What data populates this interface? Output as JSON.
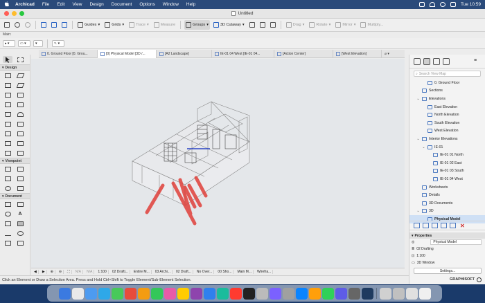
{
  "menubar": {
    "app_name": "Archicad",
    "items": [
      "File",
      "Edit",
      "View",
      "Design",
      "Document",
      "Options",
      "Window",
      "Help"
    ],
    "clock": "Tue 10:59"
  },
  "window": {
    "title": "Untitled"
  },
  "toolbar": {
    "guides": "Guides",
    "grids": "Grids",
    "trace": "Trace",
    "measure": "Measure",
    "groups": "Groups",
    "cutaway": "3D Cutaway",
    "drag": "Drag",
    "rotate": "Rotate",
    "mirror": "Mirror",
    "multiply": "Multiply..."
  },
  "infobox": {
    "label": "Main:"
  },
  "tabs": [
    {
      "label": "0. Ground Floor [0. Grou..."
    },
    {
      "label": "[0] Physical Model [3D /..."
    },
    {
      "label": "[A2 Landscape]"
    },
    {
      "label": "IE-01 04 West [IE-01 04..."
    },
    {
      "label": "[Action Center]"
    },
    {
      "label": "[West Elevation]"
    }
  ],
  "toolbox": {
    "sections": {
      "design": "Design",
      "viewpoint": "Viewpoint",
      "document": "Document"
    }
  },
  "navbar": {
    "items": [
      "N/A",
      "N/A",
      "1:100",
      "02 Drafti...",
      "Entire M...",
      "03 Archi...",
      "02 Draft...",
      "No Over...",
      "00 Sho...",
      "Main M...",
      "Wirefra..."
    ]
  },
  "status": {
    "text": "Click an Element or Draw a Selection Area. Press and Hold Ctrl+Shift to Toggle Element/Sub-Element Selection."
  },
  "navigator": {
    "search_placeholder": "Search View Map",
    "tree": [
      {
        "label": "0. Ground Floor",
        "level": 2,
        "arrow": ""
      },
      {
        "label": "Sections",
        "level": 1,
        "arrow": ""
      },
      {
        "label": "Elevations",
        "level": 1,
        "arrow": "v"
      },
      {
        "label": "East Elevation",
        "level": 2,
        "arrow": ""
      },
      {
        "label": "North Elevation",
        "level": 2,
        "arrow": ""
      },
      {
        "label": "South Elevation",
        "level": 2,
        "arrow": ""
      },
      {
        "label": "West Elevation",
        "level": 2,
        "arrow": ""
      },
      {
        "label": "Interior Elevations",
        "level": 1,
        "arrow": "v"
      },
      {
        "label": "IE-01",
        "level": 2,
        "arrow": "v"
      },
      {
        "label": "IE-01 01 North",
        "level": 3,
        "arrow": ""
      },
      {
        "label": "IE-01 02 East",
        "level": 3,
        "arrow": ""
      },
      {
        "label": "IE-01 03 South",
        "level": 3,
        "arrow": ""
      },
      {
        "label": "IE-01 04 West",
        "level": 3,
        "arrow": ""
      },
      {
        "label": "Worksheets",
        "level": 1,
        "arrow": ""
      },
      {
        "label": "Details",
        "level": 1,
        "arrow": ""
      },
      {
        "label": "3D Documents",
        "level": 1,
        "arrow": ""
      },
      {
        "label": "3D",
        "level": 1,
        "arrow": "v"
      },
      {
        "label": "Physical Model",
        "level": 2,
        "arrow": "",
        "selected": true
      }
    ],
    "properties": {
      "header": "Properties",
      "name": "Physical Model",
      "layer": "02 Drafting",
      "scale": "1:100",
      "window": "3D Window",
      "settings": "Settings..."
    },
    "brand": "GRAPHISOFT"
  },
  "colors": {
    "accent": "#2a64c4",
    "pipe": "#e0403a"
  }
}
